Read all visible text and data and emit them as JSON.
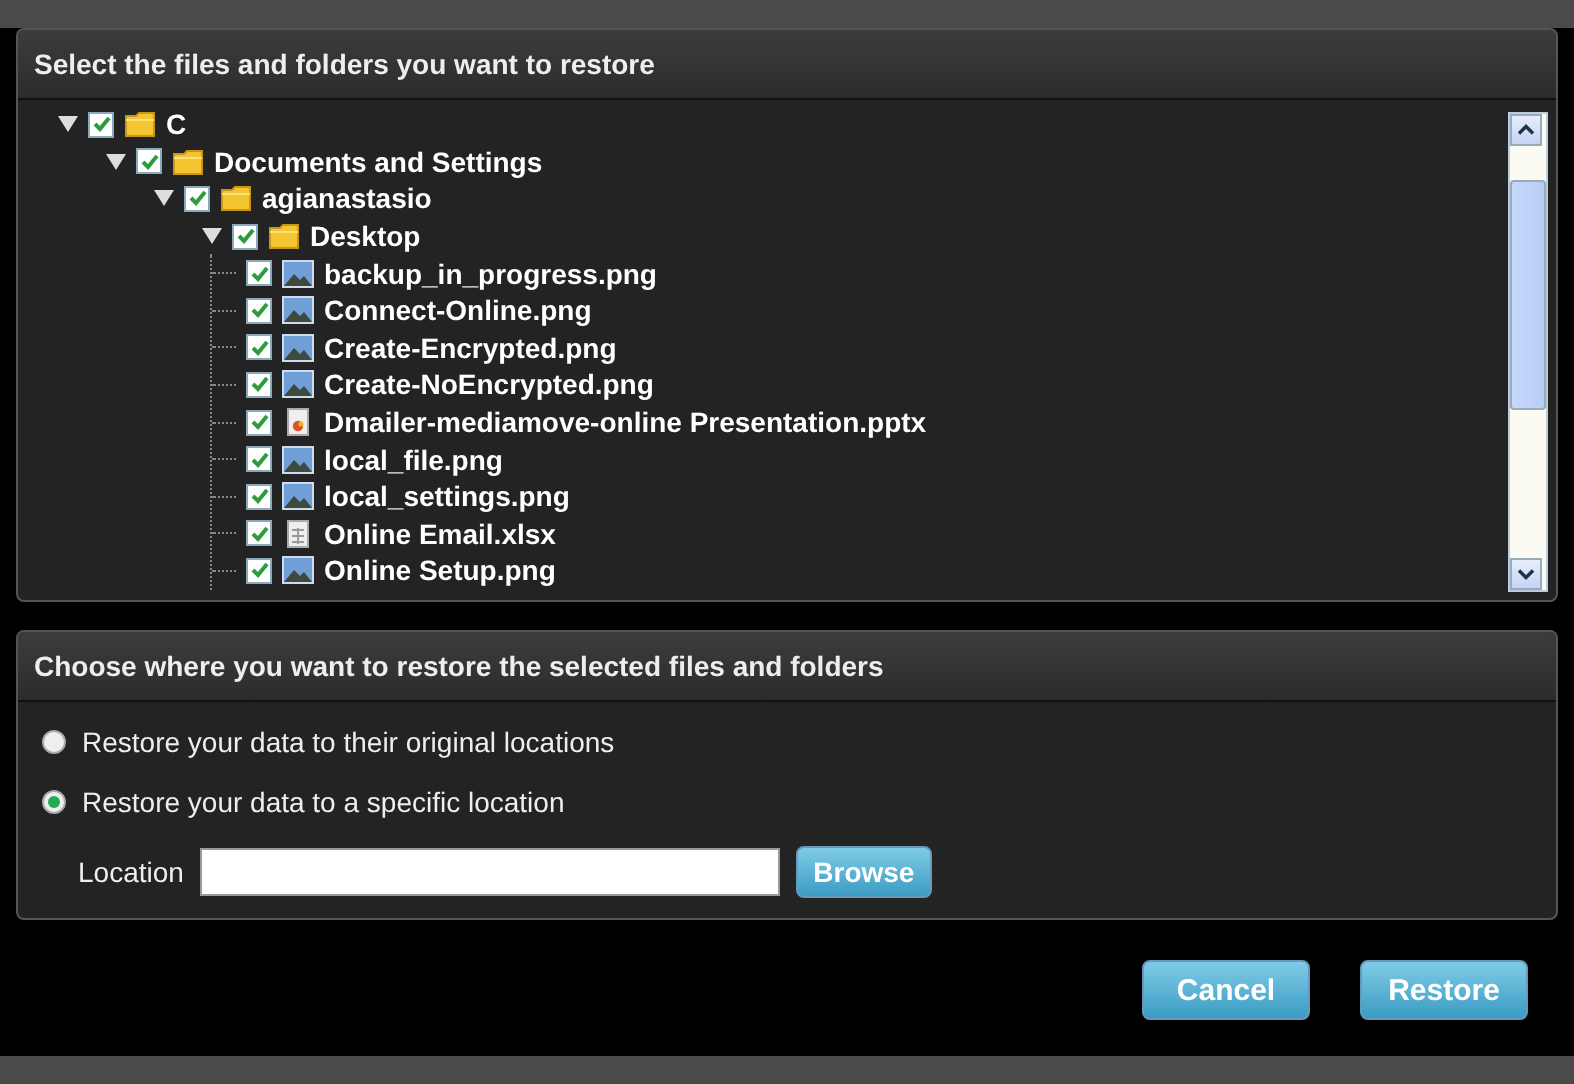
{
  "tree_panel": {
    "title": "Select the files and folders you want to restore",
    "tree": [
      {
        "label": "C",
        "kind": "folder",
        "expanded": true,
        "checked": true,
        "children": [
          {
            "label": "Documents and Settings",
            "kind": "folder",
            "expanded": true,
            "checked": true,
            "children": [
              {
                "label": "agianastasio",
                "kind": "folder",
                "expanded": true,
                "checked": true,
                "children": [
                  {
                    "label": "Desktop",
                    "kind": "folder",
                    "expanded": true,
                    "checked": true,
                    "children": [
                      {
                        "label": "backup_in_progress.png",
                        "kind": "image",
                        "checked": true
                      },
                      {
                        "label": "Connect-Online.png",
                        "kind": "image",
                        "checked": true
                      },
                      {
                        "label": "Create-Encrypted.png",
                        "kind": "image",
                        "checked": true
                      },
                      {
                        "label": "Create-NoEncrypted.png",
                        "kind": "image",
                        "checked": true
                      },
                      {
                        "label": "Dmailer-mediamove-online Presentation.pptx",
                        "kind": "presentation",
                        "checked": true
                      },
                      {
                        "label": "local_file.png",
                        "kind": "image",
                        "checked": true
                      },
                      {
                        "label": "local_settings.png",
                        "kind": "image",
                        "checked": true
                      },
                      {
                        "label": "Online Email.xlsx",
                        "kind": "spreadsheet",
                        "checked": true
                      },
                      {
                        "label": "Online Setup.png",
                        "kind": "image",
                        "checked": true
                      }
                    ]
                  }
                ]
              }
            ]
          }
        ]
      }
    ]
  },
  "destination_panel": {
    "title": "Choose where you want to restore the selected files and folders",
    "options": [
      {
        "label": "Restore your data to their original locations",
        "selected": false
      },
      {
        "label": "Restore your data to a specific location",
        "selected": true
      }
    ],
    "location": {
      "label": "Location",
      "button": "Browse"
    }
  },
  "buttons": [
    "Cancel",
    "Restore"
  ]
}
